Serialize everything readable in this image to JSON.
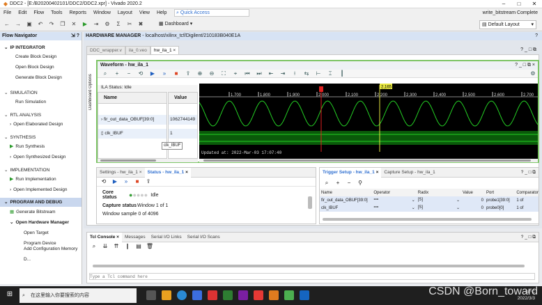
{
  "window": {
    "title": "DDC2 - [E:/B20200402101/DDC2/DDC2.xpr] - Vivado 2020.2"
  },
  "menu": {
    "items": [
      "File",
      "Edit",
      "Flow",
      "Tools",
      "Reports",
      "Window",
      "Layout",
      "View",
      "Help"
    ],
    "quick_access": "Quick Access",
    "status": "write_bitstream Complete"
  },
  "toolbar": {
    "dashboard": "Dashboard",
    "layout": "Default Layout"
  },
  "flow_nav": {
    "title": "Flow Navigator",
    "sections": [
      {
        "name": "IP INTEGRATOR",
        "items": [
          "Create Block Design",
          "Open Block Design",
          "Generate Block Design"
        ]
      },
      {
        "name": "SIMULATION",
        "items": [
          "Run Simulation"
        ]
      },
      {
        "name": "RTL ANALYSIS",
        "items": [
          "Open Elaborated Design"
        ]
      },
      {
        "name": "SYNTHESIS",
        "items": [
          "Run Synthesis",
          "Open Synthesized Design"
        ]
      },
      {
        "name": "IMPLEMENTATION",
        "items": [
          "Run Implementation",
          "Open Implemented Design"
        ]
      },
      {
        "name": "PROGRAM AND DEBUG",
        "items": [
          "Generate Bitstream",
          "Open Hardware Manager"
        ]
      }
    ],
    "hw_items": [
      "Open Target",
      "Program Device",
      "Add Configuration Memory D..."
    ]
  },
  "hw_manager": {
    "title": "HARDWARE MANAGER",
    "path": "- localhost/xilinx_tcf/Digilent/210183B040E1A"
  },
  "tabs": [
    "DDC_wrapper.v",
    "ila_0.veo",
    "hw_ila_1"
  ],
  "waveform": {
    "title": "Waveform - hw_ila_1",
    "dash_opt": "Dashboard Options",
    "ila_status": "ILA Status: Idle",
    "col_name": "Name",
    "col_value": "Value",
    "signals": [
      {
        "name": "fir_out_data_OBUF[39:0]",
        "value": "1062744149"
      },
      {
        "name": "clk_IBUF",
        "value": "1"
      }
    ],
    "tooltip": "clk_IBUF",
    "ticks": [
      "1,700",
      "1,800",
      "1,900",
      "2,000",
      "2,100",
      "2,200",
      "2,300",
      "2,400",
      "2,500",
      "2,600",
      "2,700"
    ],
    "cursor": "2,165",
    "updated": "Updated at: 2022-Mar-03 17:07:40"
  },
  "settings_panel": {
    "tab1": "Settings - hw_ila_1",
    "tab2": "Status - hw_ila_1",
    "core_status_label": "Core status",
    "core_status": "Idle",
    "capture_label": "Capture status",
    "capture": "Window 1 of 1",
    "window_sample": "Window sample 0 of 4096"
  },
  "trigger_panel": {
    "tab1": "Trigger Setup - hw_ila_1",
    "tab2": "Capture Setup - hw_ila_1",
    "headers": [
      "Name",
      "Operator",
      "Radix",
      "Value",
      "Port",
      "Comparator"
    ],
    "rows": [
      [
        "fir_out_data_OBUF[39:0]",
        "==",
        "[S]",
        "0",
        "probe1[39:0]",
        "1 of"
      ],
      [
        "clk_IBUF",
        "==",
        "[S]",
        "0",
        "probe0[0]",
        "1 of"
      ]
    ]
  },
  "tcl": {
    "tabs": [
      "Tcl Console",
      "Messages",
      "Serial I/O Links",
      "Serial I/O Scans"
    ],
    "placeholder": "Type a Tcl command here"
  },
  "taskbar": {
    "search": "在这里输入你要搜索的内容",
    "temp": "18°C",
    "date": "2022/3/3",
    "watermark": "CSDN @Born_toward"
  }
}
